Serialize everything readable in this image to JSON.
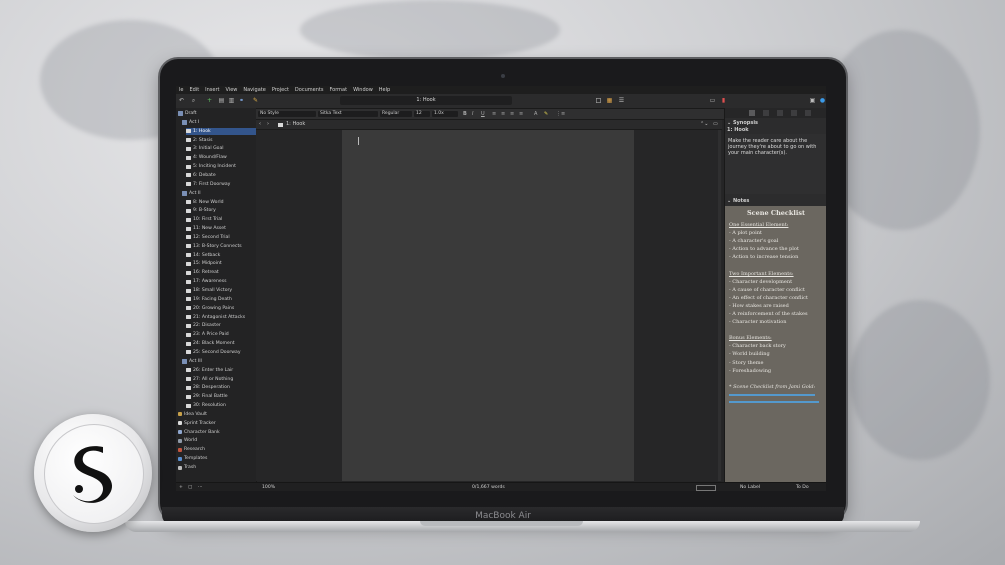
{
  "device_label": "MacBook Air",
  "menu": [
    "le",
    "Edit",
    "Insert",
    "View",
    "Navigate",
    "Project",
    "Documents",
    "Format",
    "Window",
    "Help"
  ],
  "toolbar": {
    "title": "1: Hook"
  },
  "formatbar": {
    "style": "No Style",
    "font": "Sitka Text",
    "weight": "Regular",
    "size": "12",
    "spacing": "1.0x"
  },
  "editor": {
    "breadcrumb": "1: Hook"
  },
  "binder": {
    "items": [
      {
        "label": "Draft",
        "kind": "root"
      },
      {
        "label": "Act I",
        "kind": "folder"
      },
      {
        "label": "1: Hook",
        "kind": "doc",
        "selected": true
      },
      {
        "label": "2: Stasis",
        "kind": "doc"
      },
      {
        "label": "3: Initial Goal",
        "kind": "doc"
      },
      {
        "label": "4: Wound/Flaw",
        "kind": "doc"
      },
      {
        "label": "5: Inciting Incident",
        "kind": "doc"
      },
      {
        "label": "6: Debate",
        "kind": "doc"
      },
      {
        "label": "7: First Doorway",
        "kind": "doc"
      },
      {
        "label": "Act II",
        "kind": "folder"
      },
      {
        "label": "8: New World",
        "kind": "doc"
      },
      {
        "label": "9: B-Story",
        "kind": "doc"
      },
      {
        "label": "10: First Trial",
        "kind": "doc"
      },
      {
        "label": "11: New Asset",
        "kind": "doc"
      },
      {
        "label": "12: Second Trial",
        "kind": "doc"
      },
      {
        "label": "13: B-Story Connects",
        "kind": "doc"
      },
      {
        "label": "14: Setback",
        "kind": "doc"
      },
      {
        "label": "15: Midpoint",
        "kind": "doc"
      },
      {
        "label": "16: Retreat",
        "kind": "doc"
      },
      {
        "label": "17: Awareness",
        "kind": "doc"
      },
      {
        "label": "18: Small Victory",
        "kind": "doc"
      },
      {
        "label": "19: Facing Death",
        "kind": "doc"
      },
      {
        "label": "20: Growing Pains",
        "kind": "doc"
      },
      {
        "label": "21: Antagonist Attacks",
        "kind": "doc"
      },
      {
        "label": "22: Disaster",
        "kind": "doc"
      },
      {
        "label": "23: A Price Paid",
        "kind": "doc"
      },
      {
        "label": "24: Black Moment",
        "kind": "doc"
      },
      {
        "label": "25: Second Doorway",
        "kind": "doc"
      },
      {
        "label": "Act III",
        "kind": "folder"
      },
      {
        "label": "26: Enter the Lair",
        "kind": "doc"
      },
      {
        "label": "27: All or Nothing",
        "kind": "doc"
      },
      {
        "label": "28: Desperation",
        "kind": "doc"
      },
      {
        "label": "29: Final Battle",
        "kind": "doc"
      },
      {
        "label": "30: Resolution",
        "kind": "doc"
      },
      {
        "label": "Idea Vault",
        "kind": "top",
        "color": "#c8a14a"
      },
      {
        "label": "Sprint Tracker",
        "kind": "top",
        "color": "#dcdcdc"
      },
      {
        "label": "Character Bank",
        "kind": "top",
        "color": "#8fa7cf"
      },
      {
        "label": "World",
        "kind": "top",
        "color": "#8f9aa8"
      },
      {
        "label": "Research",
        "kind": "top",
        "color": "#c2553f"
      },
      {
        "label": "Templates",
        "kind": "top",
        "color": "#5a8fd1"
      },
      {
        "label": "Trash",
        "kind": "top",
        "color": "#bdbdbd"
      }
    ]
  },
  "inspector": {
    "synopsis_header": "Synopsis",
    "synopsis_title": "1: Hook",
    "synopsis_text": "Make the reader care about the journey they're about to go on with your main character(s).",
    "notes_header": "Notes",
    "notes": {
      "title": "Scene Checklist",
      "sec1": "One Essential Element:",
      "list1": [
        "- A plot point",
        "- A character's goal",
        "- Action to advance the plot",
        "- Action to increase tension"
      ],
      "sec2": "Two Important Elements:",
      "list2": [
        "- Character development",
        "- A cause of character conflict",
        "- An effect of character conflict",
        "- How stakes are raised",
        "- A reinforcement of the stakes",
        "- Character motivation"
      ],
      "sec3": "Bonus Elements:",
      "list3": [
        "- Character back story",
        "- World building",
        "- Story theme",
        "- Foreshadowing"
      ],
      "credit": "* Scene Checklist from Jami Gold:"
    }
  },
  "footer": {
    "zoom": "100%",
    "words": "0/1,667 words",
    "label": "No Label",
    "status": "To Do"
  }
}
